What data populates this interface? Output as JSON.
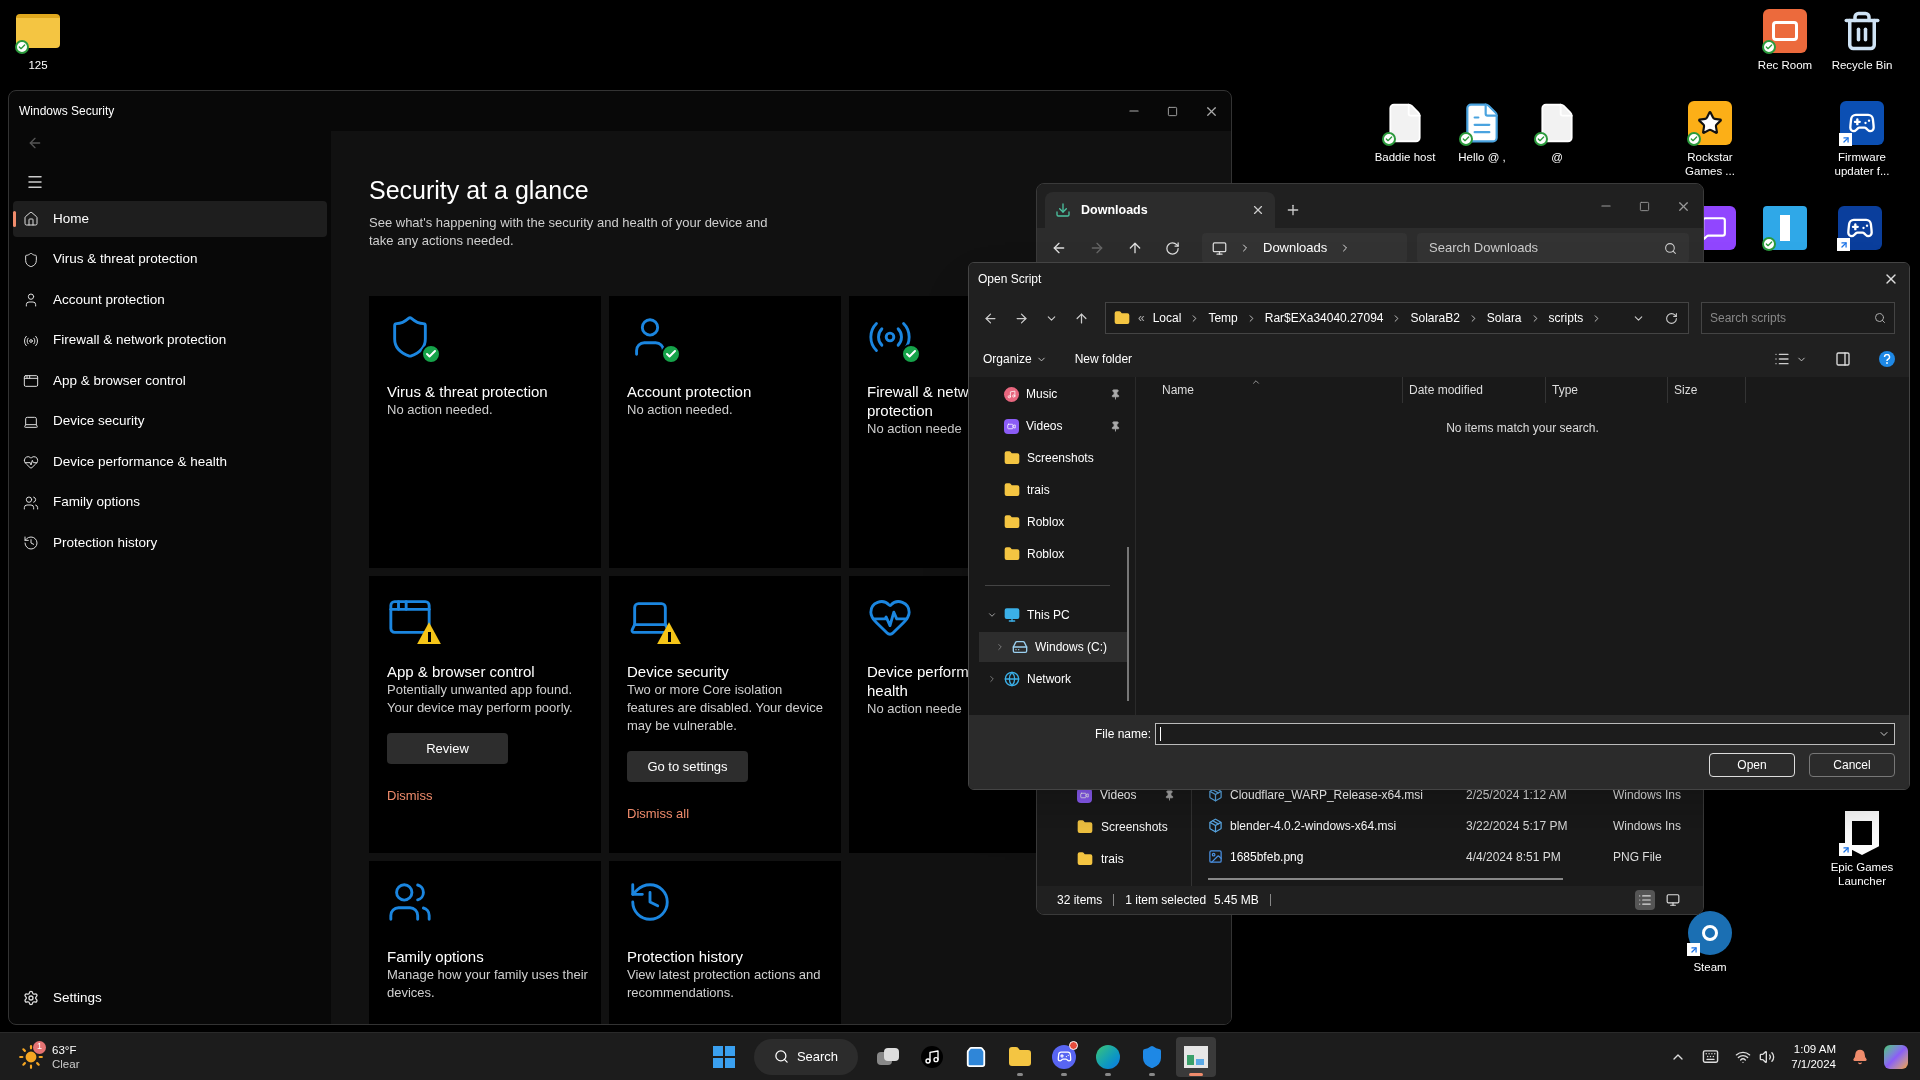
{
  "desktop_icons": [
    {
      "kind": "folder",
      "label": "125",
      "synced": true,
      "shortcut": false
    },
    {
      "kind": "recroom",
      "label": "Rec Room",
      "synced": true,
      "shortcut": false
    },
    {
      "kind": "recycle",
      "label": "Recycle Bin",
      "synced": false,
      "shortcut": false
    },
    {
      "kind": "document",
      "label": "Baddie host",
      "synced": true,
      "shortcut": false
    },
    {
      "kind": "notepad",
      "label": "Hello @ ,",
      "synced": true,
      "shortcut": false
    },
    {
      "kind": "document",
      "label": "@",
      "synced": true,
      "shortcut": false
    },
    {
      "kind": "rockstar",
      "label": "Rockstar Games ...",
      "synced": true,
      "shortcut": false
    },
    {
      "kind": "firmware",
      "label": "Firmware updater f...",
      "synced": false,
      "shortcut": true
    },
    {
      "kind": "twitch",
      "synced": false,
      "shortcut": false
    },
    {
      "kind": "fortnite",
      "synced": true,
      "shortcut": false
    },
    {
      "kind": "playstation",
      "synced": false,
      "shortcut": true
    },
    {
      "kind": "epic",
      "label": "Epic Games Launcher",
      "synced": false,
      "shortcut": true
    },
    {
      "kind": "steam",
      "label": "Steam",
      "synced": false,
      "shortcut": true
    }
  ],
  "security": {
    "window_title": "Windows Security",
    "nav": [
      {
        "kind": "home",
        "label": "Home",
        "selected": true
      },
      {
        "kind": "shield",
        "label": "Virus & threat protection",
        "selected": false
      },
      {
        "kind": "account",
        "label": "Account protection",
        "selected": false
      },
      {
        "kind": "antenna",
        "label": "Firewall & network protection",
        "selected": false
      },
      {
        "kind": "browser",
        "label": "App & browser control",
        "selected": false
      },
      {
        "kind": "laptop",
        "label": "Device security",
        "selected": false
      },
      {
        "kind": "heart",
        "label": "Device performance & health",
        "selected": false
      },
      {
        "kind": "family",
        "label": "Family options",
        "selected": false
      },
      {
        "kind": "history",
        "label": "Protection history",
        "selected": false
      }
    ],
    "settings": "Settings",
    "heading": "Security at a glance",
    "subheading": "See what's happening with the security and health of your device and take any actions needed.",
    "cards": [
      {
        "kind": "shield",
        "healthy": true,
        "warning": false,
        "title": "Virus & threat protection",
        "status": "No action needed."
      },
      {
        "kind": "account",
        "healthy": true,
        "warning": false,
        "title": "Account protection",
        "status": "No action needed."
      },
      {
        "kind": "antenna",
        "healthy": true,
        "warning": false,
        "title": "Firewall & netw\nprotection",
        "status": "No action neede"
      },
      {
        "kind": "browser",
        "healthy": false,
        "warning": true,
        "title": "App & browser control",
        "status": "Potentially unwanted app found. Your device may perform poorly.",
        "button": "Review",
        "link": "Dismiss"
      },
      {
        "kind": "laptop",
        "healthy": false,
        "warning": true,
        "title": "Device security",
        "status": "Two or more Core isolation features are disabled.  Your device may be vulnerable.",
        "button": "Go to settings",
        "link": "Dismiss all"
      },
      {
        "kind": "heart",
        "healthy": false,
        "warning": false,
        "title": "Device perform\nhealth",
        "status": "No action neede"
      },
      {
        "kind": "family",
        "healthy": false,
        "warning": false,
        "title": "Family options",
        "status": "Manage how your family uses their devices."
      },
      {
        "kind": "history",
        "healthy": false,
        "warning": false,
        "title": "Protection history",
        "status": "View latest protection actions and recommendations."
      }
    ]
  },
  "downloads": {
    "tab": "Downloads",
    "address": "Downloads",
    "search_placeholder": "Search Downloads",
    "sidebar": [
      {
        "kind": "video",
        "label": "Videos",
        "pinned": true
      },
      {
        "kind": "folder",
        "label": "Screenshots",
        "pinned": false
      },
      {
        "kind": "folder",
        "label": "trais",
        "pinned": false
      }
    ],
    "files": [
      {
        "kind": "installer",
        "name": "Cloudflare_WARP_Release-x64.msi",
        "date": "2/25/2024 1:12 AM",
        "type": "Windows Ins"
      },
      {
        "kind": "installer",
        "name": "blender-4.0.2-windows-x64.msi",
        "date": "3/22/2024 5:17 PM",
        "type": "Windows Ins"
      },
      {
        "kind": "image",
        "name": "1685bfeb.png",
        "date": "4/4/2024 8:51 PM",
        "type": "PNG File"
      }
    ],
    "status": [
      "32 items",
      "1 item selected",
      "5.45 MB"
    ],
    "views": [
      {
        "kind": "details",
        "selected": true
      },
      {
        "kind": "tiles",
        "selected": false
      }
    ]
  },
  "open_dialog": {
    "title": "Open Script",
    "overflow": "«",
    "path": [
      "Local",
      "Temp",
      "Rar$EXa34040.27094",
      "SolaraB2",
      "Solara",
      "scripts"
    ],
    "search_placeholder": "Search scripts",
    "organize": "Organize",
    "new_folder": "New folder",
    "tree": [
      {
        "kind": "music",
        "label": "Music",
        "pinned": true,
        "selected": false
      },
      {
        "kind": "video",
        "label": "Videos",
        "pinned": true,
        "selected": false
      },
      {
        "kind": "folder",
        "label": "Screenshots",
        "pinned": false,
        "selected": false
      },
      {
        "kind": "folder",
        "label": "trais",
        "pinned": false,
        "selected": false
      },
      {
        "kind": "folder",
        "label": "Roblox",
        "pinned": false,
        "selected": false
      },
      {
        "kind": "folder",
        "label": "Roblox",
        "pinned": false,
        "selected": false
      },
      {
        "kind": "pc",
        "label": "This PC",
        "expanded": true,
        "selected": false,
        "children": [
          {
            "kind": "drive",
            "label": "Windows (C:)",
            "expanded": false,
            "selected": true
          }
        ]
      },
      {
        "kind": "network",
        "label": "Network",
        "expanded": false,
        "selected": false
      }
    ],
    "columns": [
      "Name",
      "Date modified",
      "Type",
      "Size"
    ],
    "empty_message": "No items match your search.",
    "file_name_label": "File name:",
    "buttons": [
      "Open",
      "Cancel"
    ]
  },
  "taskbar": {
    "weather": {
      "temp": "63°F",
      "condition": "Clear",
      "badge": "1"
    },
    "apps": [
      {
        "kind": "start",
        "running": false,
        "active": false,
        "notification": false
      },
      {
        "kind": "search",
        "label": "Search",
        "running": false,
        "active": false,
        "notification": false
      },
      {
        "kind": "taskview",
        "running": false,
        "active": false,
        "notification": false
      },
      {
        "kind": "tiktok",
        "running": false,
        "active": false,
        "notification": false
      },
      {
        "kind": "store",
        "running": false,
        "active": false,
        "notification": false
      },
      {
        "kind": "explorer",
        "running": true,
        "active": false,
        "notification": false
      },
      {
        "kind": "discord",
        "running": true,
        "active": false,
        "notification": true
      },
      {
        "kind": "edge",
        "running": true,
        "active": false,
        "notification": false
      },
      {
        "kind": "defender",
        "running": true,
        "active": false,
        "notification": false
      },
      {
        "kind": "app",
        "running": true,
        "active": true,
        "notification": false
      }
    ],
    "clock": {
      "time": "1:09 AM",
      "date": "7/1/2024"
    }
  }
}
